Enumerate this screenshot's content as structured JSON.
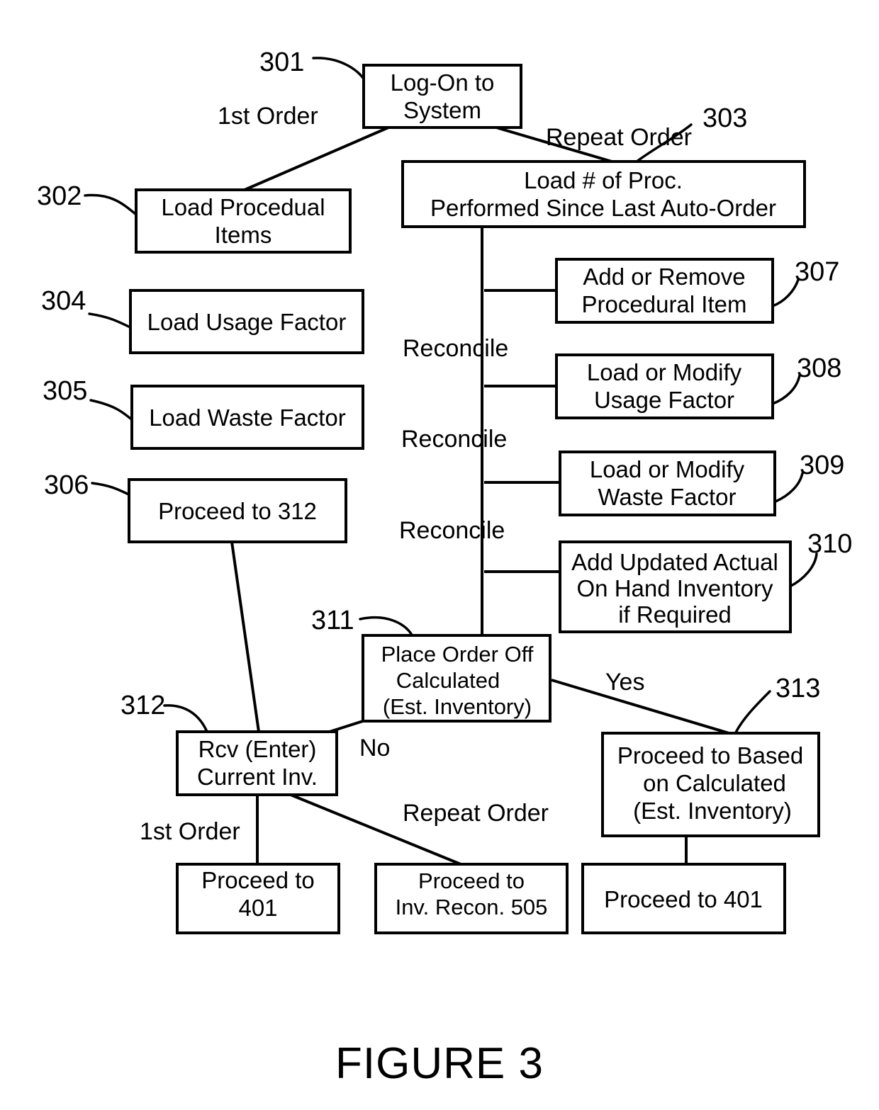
{
  "figure": {
    "caption": "FIGURE 3"
  },
  "nodes": {
    "n301": {
      "ref": "301",
      "lines": [
        "Log-On to",
        "System"
      ]
    },
    "n302": {
      "ref": "302",
      "lines": [
        "Load Procedual",
        "Items"
      ]
    },
    "n303": {
      "ref": "303",
      "lines": [
        "Load # of Proc.",
        "Performed Since Last Auto-Order"
      ]
    },
    "n304": {
      "ref": "304",
      "lines": [
        "Load Usage Factor"
      ]
    },
    "n305": {
      "ref": "305",
      "lines": [
        "Load Waste Factor"
      ]
    },
    "n306": {
      "ref": "306",
      "lines": [
        "Proceed to 312"
      ]
    },
    "n307": {
      "ref": "307",
      "lines": [
        "Add or Remove",
        "Procedural Item"
      ]
    },
    "n308": {
      "ref": "308",
      "lines": [
        "Load or Modify",
        "Usage Factor"
      ]
    },
    "n309": {
      "ref": "309",
      "lines": [
        "Load or Modify",
        "Waste Factor"
      ]
    },
    "n310": {
      "ref": "310",
      "lines": [
        "Add Updated Actual",
        "On Hand Inventory",
        "if Required"
      ]
    },
    "n311": {
      "ref": "311",
      "lines": [
        "Place Order Off",
        "Calculated",
        "(Est. Inventory)"
      ]
    },
    "n312": {
      "ref": "312",
      "lines": [
        "Rcv (Enter)",
        "Current Inv."
      ]
    },
    "n313": {
      "ref": "313",
      "lines": [
        "Proceed to Based",
        "on Calculated",
        "(Est. Inventory)"
      ]
    },
    "n314": {
      "ref": "",
      "lines": [
        "Proceed to",
        "401"
      ]
    },
    "n315": {
      "ref": "",
      "lines": [
        "Proceed to",
        "Inv. Recon. 505"
      ]
    },
    "n316": {
      "ref": "",
      "lines": [
        "Proceed to 401"
      ]
    }
  },
  "edge_labels": {
    "first_order_top": "1st Order",
    "repeat_order_top": "Repeat Order",
    "reconcile_1": "Reconcile",
    "reconcile_2": "Reconcile",
    "reconcile_3": "Reconcile",
    "yes": "Yes",
    "no": "No",
    "first_order_bottom": "1st Order",
    "repeat_order_bottom": "Repeat Order"
  },
  "colors": {
    "ink": "#000000",
    "paper": "#ffffff"
  }
}
